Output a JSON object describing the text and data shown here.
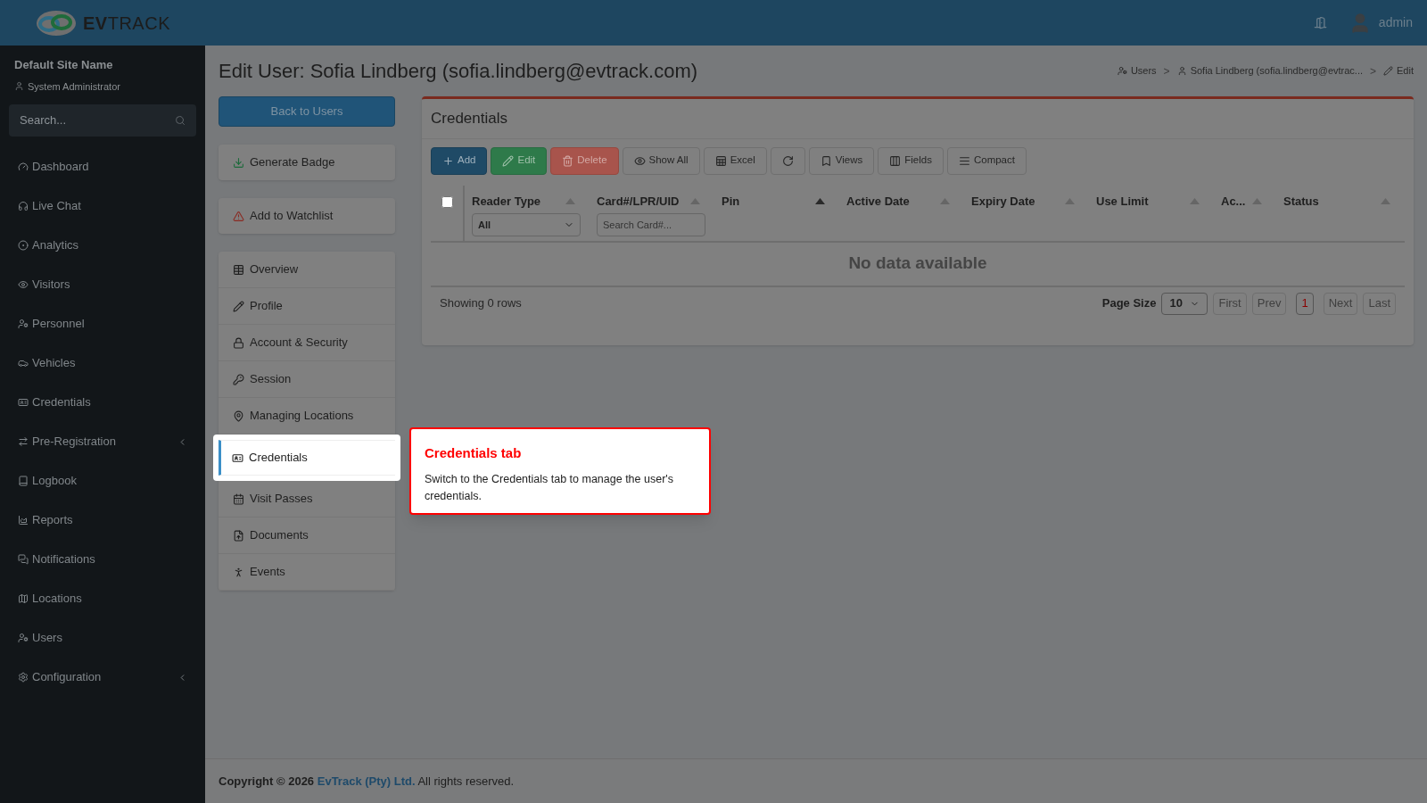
{
  "header": {
    "logo": {
      "bold": "EV",
      "light": "TRACK"
    },
    "user": "admin"
  },
  "sidebar": {
    "site_name": "Default Site Name",
    "role": "System Administrator",
    "search": {
      "placeholder": "Search..."
    },
    "items": [
      {
        "label": "Dashboard",
        "has_submenu": false
      },
      {
        "label": "Live Chat",
        "has_submenu": false
      },
      {
        "label": "Analytics",
        "has_submenu": false
      },
      {
        "label": "Visitors",
        "has_submenu": false
      },
      {
        "label": "Personnel",
        "has_submenu": false
      },
      {
        "label": "Vehicles",
        "has_submenu": false
      },
      {
        "label": "Credentials",
        "has_submenu": false
      },
      {
        "label": "Pre-Registration",
        "has_submenu": true
      },
      {
        "label": "Logbook",
        "has_submenu": false
      },
      {
        "label": "Reports",
        "has_submenu": false
      },
      {
        "label": "Notifications",
        "has_submenu": false
      },
      {
        "label": "Locations",
        "has_submenu": false
      },
      {
        "label": "Users",
        "has_submenu": false
      },
      {
        "label": "Configuration",
        "has_submenu": true
      }
    ]
  },
  "page": {
    "title": "Edit User: Sofia Lindberg (sofia.lindberg@evtrack.com)",
    "breadcrumbs": [
      "Users",
      "Sofia Lindberg (sofia.lindberg@evtrac...",
      "Edit"
    ],
    "breadcrumb_separator": ">",
    "back_button": "Back to Users",
    "actions": [
      "Generate Badge",
      "Add to Watchlist"
    ],
    "tabs": [
      {
        "label": "Overview",
        "selected": false
      },
      {
        "label": "Profile",
        "selected": false
      },
      {
        "label": "Account & Security",
        "selected": false
      },
      {
        "label": "Session",
        "selected": false
      },
      {
        "label": "Managing Locations",
        "selected": false
      },
      {
        "label": "Credentials",
        "selected": true
      },
      {
        "label": "Visit Passes",
        "selected": false
      },
      {
        "label": "Documents",
        "selected": false
      },
      {
        "label": "Events",
        "selected": false
      }
    ]
  },
  "credentials": {
    "title": "Credentials",
    "toolbar": [
      {
        "label": "Add",
        "kind": "add"
      },
      {
        "label": "Edit",
        "kind": "edit"
      },
      {
        "label": "Delete",
        "kind": "delete"
      },
      {
        "label": "Show All",
        "kind": "show"
      },
      {
        "label": "Excel",
        "kind": "excel"
      },
      {
        "kind": "refresh"
      },
      {
        "label": "Views",
        "kind": "views"
      },
      {
        "label": "Fields",
        "kind": "fields"
      },
      {
        "label": "Compact",
        "kind": "compact"
      }
    ],
    "select_all": {
      "checked": false
    },
    "columns": [
      {
        "label": "Reader Type",
        "sorted": false,
        "filter": {
          "kind": "select",
          "value": "All"
        }
      },
      {
        "label": "Card#/LPR/UID",
        "sorted": false,
        "filter": {
          "kind": "search",
          "placeholder": "Search Card#..."
        }
      },
      {
        "label": "Pin",
        "sorted": true
      },
      {
        "label": "Active Date",
        "sorted": false
      },
      {
        "label": "Expiry Date",
        "sorted": false
      },
      {
        "label": "Use Limit",
        "sorted": false
      },
      {
        "label": "Ac...",
        "sorted": false
      },
      {
        "label": "Status",
        "sorted": false
      }
    ],
    "empty_text": "No data available",
    "row_count": "Showing 0 rows",
    "page_size": {
      "label": "Page Size",
      "value": "10"
    },
    "pager": [
      {
        "label": "First",
        "selected": false
      },
      {
        "label": "Prev",
        "selected": false
      },
      {
        "label": "1",
        "selected": true
      },
      {
        "label": "Next",
        "selected": false
      },
      {
        "label": "Last",
        "selected": false
      }
    ]
  },
  "tour": {
    "title": "Credentials tab",
    "text": "Switch to the Credentials tab to manage the user's credentials."
  },
  "footer": {
    "prefix": "Copyright © 2026",
    "company": "EvTrack (Pty) Ltd.",
    "suffix": "All rights reserved."
  }
}
